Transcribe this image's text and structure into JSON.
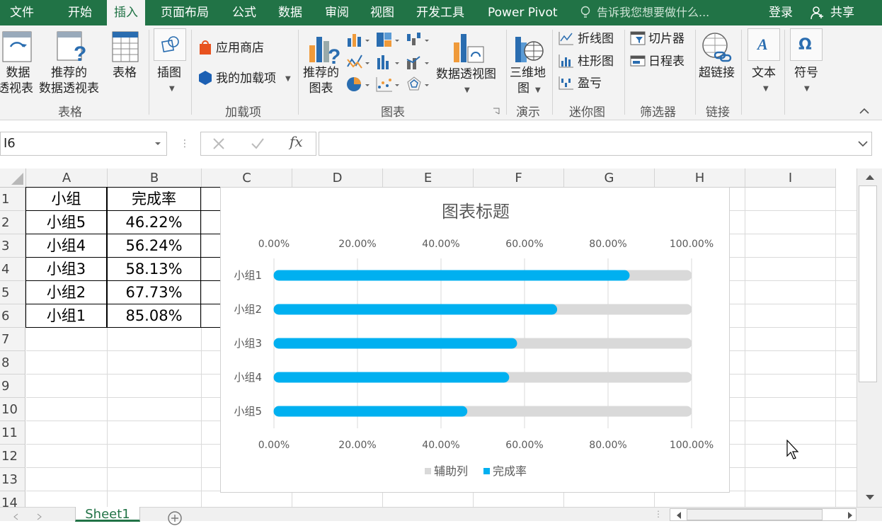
{
  "menu": {
    "tabs": [
      "文件",
      "开始",
      "插入",
      "页面布局",
      "公式",
      "数据",
      "审阅",
      "视图",
      "开发工具",
      "Power Pivot"
    ],
    "active": "插入",
    "tell_me": "告诉我您想要做什么...",
    "login": "登录",
    "share": "共享"
  },
  "ribbon": {
    "pivot_line1": "数据",
    "pivot_line2": "透视表",
    "rec_pivot_line1": "推荐的",
    "rec_pivot_line2": "数据透视表",
    "table": "表格",
    "illustration": "插图",
    "store": "应用商店",
    "my_addins": "我的加载项",
    "rec_chart_line1": "推荐的",
    "rec_chart_line2": "图表",
    "pivot_chart": "数据透视图",
    "map3d_line1": "三维地",
    "map3d_line2": "图",
    "spark_line": "折线图",
    "spark_column": "柱形图",
    "spark_winloss": "盈亏",
    "slicer": "切片器",
    "timeline": "日程表",
    "hyperlink": "超链接",
    "text": "文本",
    "symbol": "符号",
    "groups": {
      "tables": "表格",
      "addins": "加载项",
      "charts": "图表",
      "tours": "演示",
      "sparklines": "迷你图",
      "filters": "筛选器",
      "links": "链接"
    }
  },
  "formula_bar": {
    "name_box": "I6",
    "fx": "fx",
    "value": ""
  },
  "sheet": {
    "columns": [
      "A",
      "B",
      "C",
      "D",
      "E",
      "F",
      "G",
      "H",
      "I"
    ],
    "rows": [
      "1",
      "2",
      "3",
      "4",
      "5",
      "6",
      "7",
      "8",
      "9",
      "10",
      "11",
      "12",
      "13",
      "14"
    ],
    "header_row": [
      "小组",
      "完成率"
    ],
    "data": [
      [
        "小组5",
        "46.22%"
      ],
      [
        "小组4",
        "56.24%"
      ],
      [
        "小组3",
        "58.13%"
      ],
      [
        "小组2",
        "67.73%"
      ],
      [
        "小组1",
        "85.08%"
      ]
    ],
    "tab": "Sheet1"
  },
  "chart_data": {
    "type": "bar",
    "title": "图表标题",
    "categories": [
      "小组1",
      "小组2",
      "小组3",
      "小组4",
      "小组5"
    ],
    "series": [
      {
        "name": "辅助列",
        "values": [
          1,
          1,
          1,
          1,
          1
        ],
        "color": "#d9d9d9"
      },
      {
        "name": "完成率",
        "values": [
          0.8508,
          0.6773,
          0.5813,
          0.5624,
          0.4622
        ],
        "color": "#00b0f0"
      }
    ],
    "xlim": [
      0,
      1
    ],
    "ticks": [
      "0.00%",
      "20.00%",
      "40.00%",
      "60.00%",
      "80.00%",
      "100.00%"
    ],
    "grid": true,
    "legend": "bottom"
  }
}
